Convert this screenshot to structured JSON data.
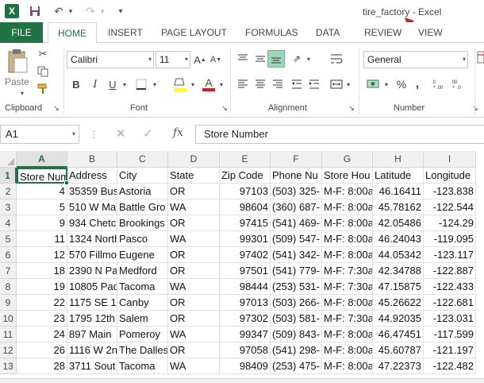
{
  "titlebar": {
    "logo": "X",
    "title": "tire_factory - Excel"
  },
  "tabs": [
    "FILE",
    "HOME",
    "INSERT",
    "PAGE LAYOUT",
    "FORMULAS",
    "DATA",
    "REVIEW",
    "VIEW"
  ],
  "ribbon": {
    "clipboard": {
      "label": "Clipboard",
      "paste": "Paste"
    },
    "font": {
      "label": "Font",
      "name": "Calibri",
      "size": "11",
      "bold": "B",
      "italic": "I",
      "underline": "U",
      "grow": "A",
      "shrink": "A",
      "color_letter": "A"
    },
    "alignment": {
      "label": "Alignment"
    },
    "number": {
      "label": "Number",
      "format": "General",
      "percent": "%",
      "comma": ","
    }
  },
  "formula_bar": {
    "name_box": "A1",
    "fx": "fx",
    "value": "Store Number"
  },
  "grid": {
    "columns": [
      "A",
      "B",
      "C",
      "D",
      "E",
      "F",
      "G",
      "H",
      "I"
    ],
    "rows": [
      "1",
      "2",
      "3",
      "4",
      "5",
      "6",
      "7",
      "8",
      "9",
      "10",
      "11",
      "12",
      "13"
    ],
    "header": [
      "Store Num",
      "Address",
      "City",
      "State",
      "Zip Code",
      "Phone Nu",
      "Store Hou",
      "Latitude",
      "Longitude"
    ],
    "data": [
      [
        "4",
        "35359 Bus",
        "Astoria",
        "OR",
        "97103",
        "(503) 325-",
        "M-F: 8:00a",
        "46.16411",
        "-123.838"
      ],
      [
        "5",
        "510 W Mai",
        "Battle Gro",
        "WA",
        "98604",
        "(360) 687-",
        "M-F: 8:00a",
        "45.78162",
        "-122.544"
      ],
      [
        "9",
        "934 Chetc",
        "Brookings",
        "OR",
        "97415",
        "(541) 469-",
        "M-F: 8:00a",
        "42.05486",
        "-124.29"
      ],
      [
        "11",
        "1324 North",
        "Pasco",
        "WA",
        "99301",
        "(509) 547-",
        "M-F: 8:00a",
        "46.24043",
        "-119.095"
      ],
      [
        "12",
        "570 Fillmo",
        "Eugene",
        "OR",
        "97402",
        "(541) 342-",
        "M-F: 8:00a",
        "44.05342",
        "-123.117"
      ],
      [
        "18",
        "2390 N Pa",
        "Medford",
        "OR",
        "97501",
        "(541) 779-",
        "M-F: 7:30a",
        "42.34788",
        "-122.887"
      ],
      [
        "19",
        "10805 Pac",
        "Tacoma",
        "WA",
        "98444",
        "(253) 531-",
        "M-F: 7:30a",
        "47.15875",
        "-122.433"
      ],
      [
        "22",
        "1175 SE 1s",
        "Canby",
        "OR",
        "97013",
        "(503) 266-",
        "M-F: 8:00a",
        "45.26622",
        "-122.681"
      ],
      [
        "23",
        "1795 12th",
        "Salem",
        "OR",
        "97302",
        "(503) 581-",
        "M-F: 7:30a",
        "44.92035",
        "-123.031"
      ],
      [
        "24",
        "897 Main",
        "Pomeroy",
        "WA",
        "99347",
        "(509) 843-",
        "M-F: 8:00a",
        "46.47451",
        "-117.599"
      ],
      [
        "26",
        "1116 W 2n",
        "The Dalles",
        "OR",
        "97058",
        "(541) 298-",
        "M-F: 8:00a",
        "45.60787",
        "-121.197"
      ],
      [
        "28",
        "3711 Sout",
        "Tacoma",
        "WA",
        "98409",
        "(253) 475-",
        "M-F: 8:00a",
        "47.22373",
        "-122.482"
      ]
    ]
  }
}
